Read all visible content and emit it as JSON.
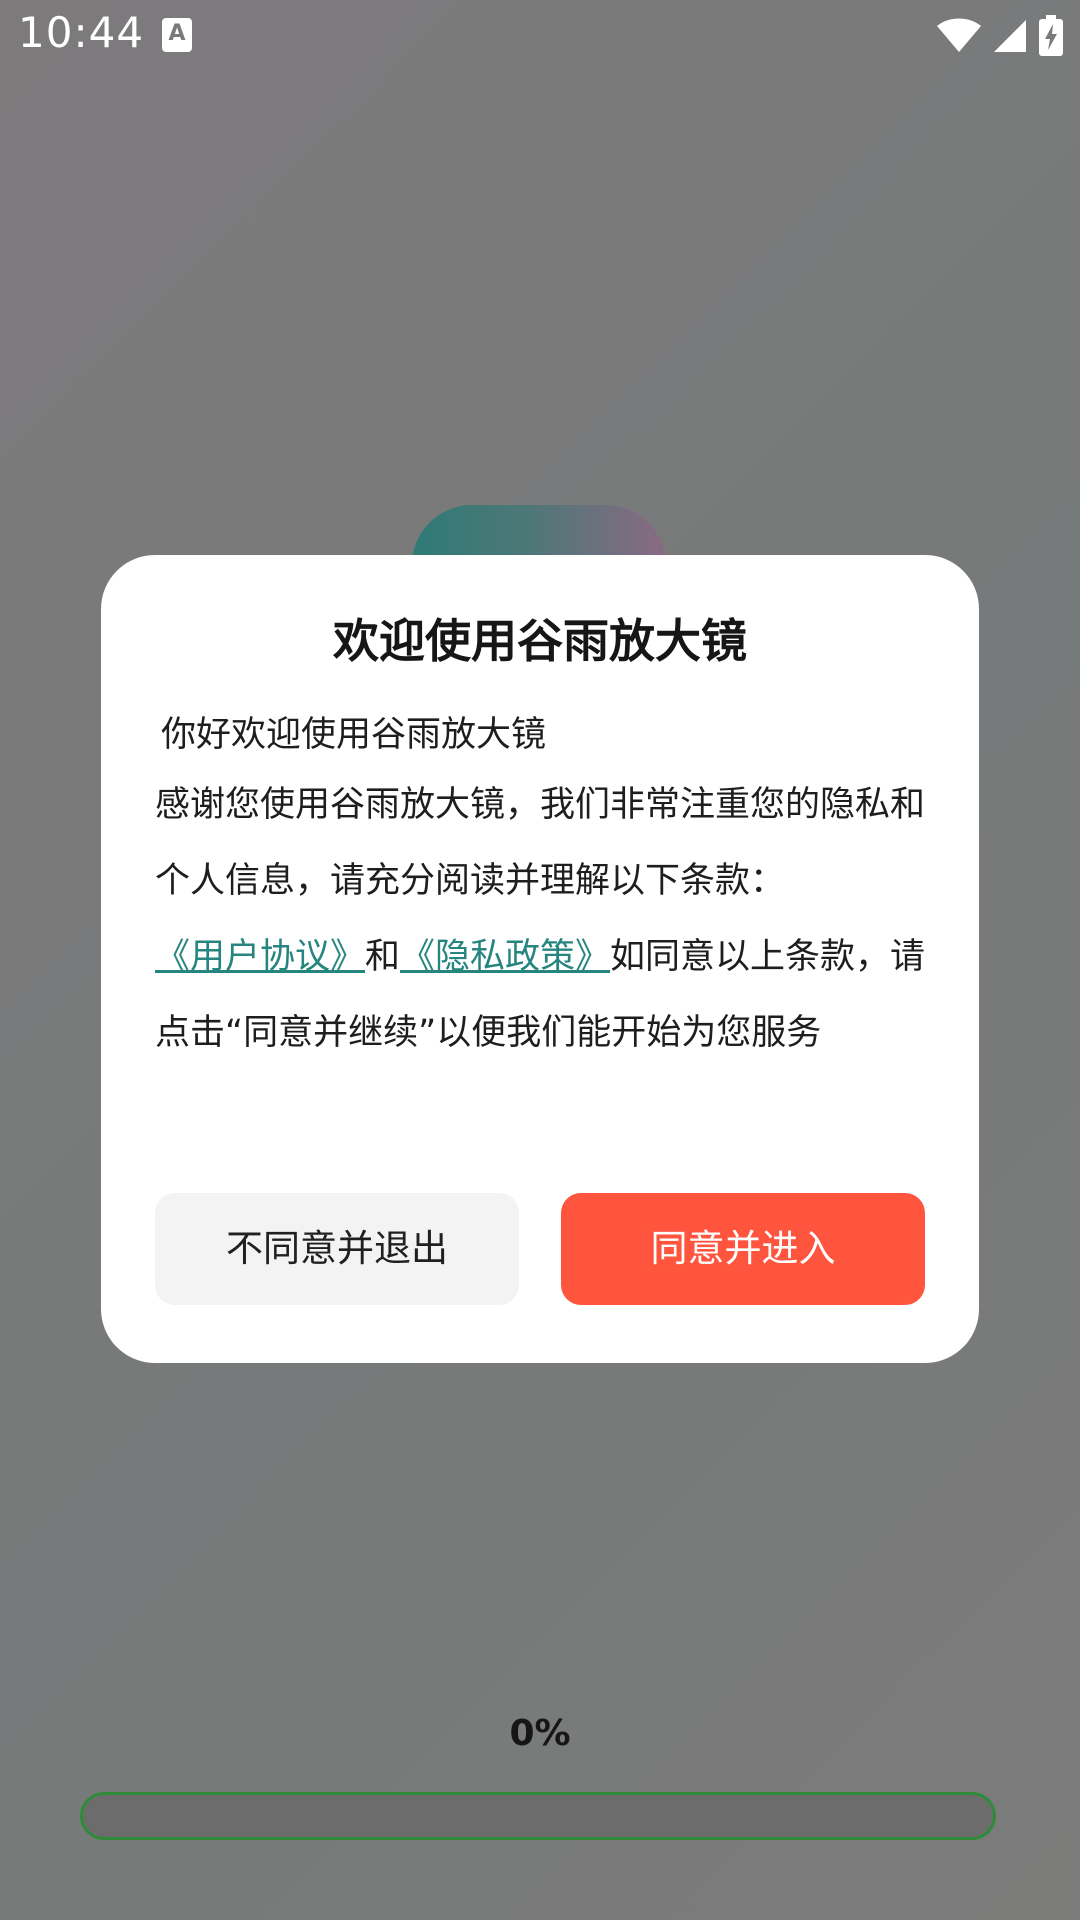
{
  "status_bar": {
    "time": "10:44",
    "notification_icon": "text-a-icon",
    "notification_glyph": "A",
    "icons": [
      "wifi-icon",
      "cell-signal-icon",
      "battery-charging-icon"
    ]
  },
  "dialog": {
    "title": "欢迎使用谷雨放大镜",
    "greeting": "你好欢迎使用谷雨放大镜",
    "text_1": "感谢您使用谷雨放大镜，我们非常注重您的隐私和个人信息，请充分阅读并理解以下条款：",
    "link_user_agreement": "《用户协议》",
    "text_and": "和",
    "link_privacy_policy": "《隐私政策》",
    "text_2": "如同意以上条款，请点击“同意并继续”以便我们能开始为您服务",
    "decline_label": "不同意并退出",
    "accept_label": "同意并进入"
  },
  "progress": {
    "label": "0%",
    "value": 0
  },
  "colors": {
    "accent": "#ff543e",
    "link": "#27857f",
    "progress_border": "#2f8a3a"
  }
}
